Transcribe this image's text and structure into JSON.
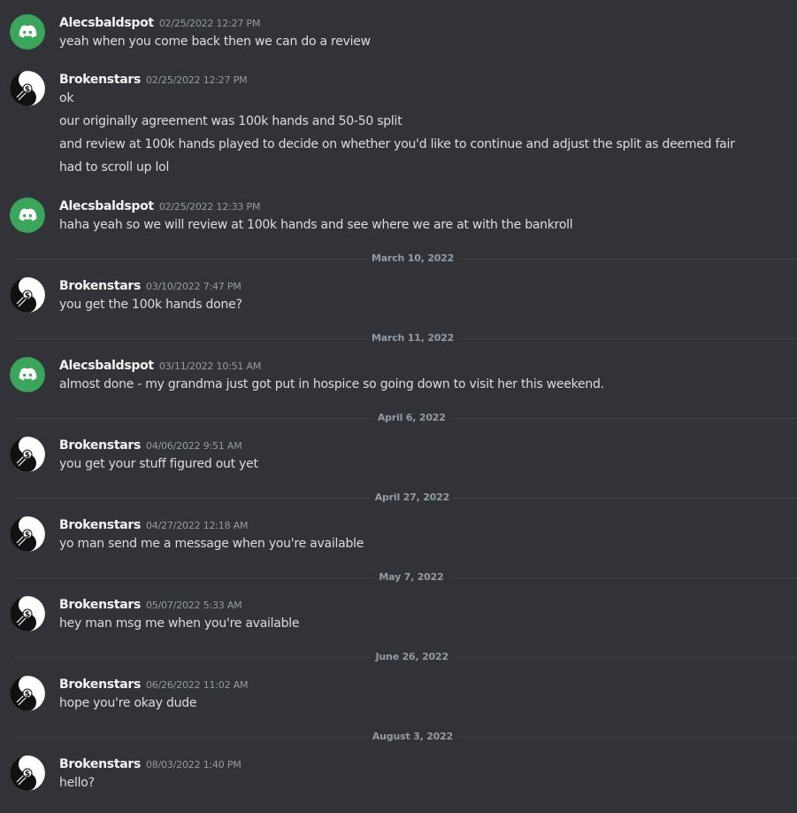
{
  "users": {
    "alec": {
      "name": "Alecsbaldspot",
      "avatar_icon": "discord-logo-icon",
      "avatar_color": "#3ba55c"
    },
    "broken": {
      "name": "Brokenstars",
      "avatar_icon": "yin-yang-dollar-icon"
    }
  },
  "messages": [
    {
      "author": "Alecsbaldspot",
      "timestamp": "02/25/2022 12:27 PM",
      "lines": [
        "yeah when you come back then we can do a review"
      ]
    },
    {
      "author": "Brokenstars",
      "timestamp": "02/25/2022 12:27 PM",
      "lines": [
        "ok",
        "our originally agreement was 100k hands and 50-50 split",
        "and review at 100k hands played to decide on whether you'd like to continue and adjust the split as deemed fair",
        "had to scroll up lol"
      ]
    },
    {
      "author": "Alecsbaldspot",
      "timestamp": "02/25/2022 12:33 PM",
      "lines": [
        "haha yeah so we will review at 100k hands and see where we are at with the bankroll"
      ]
    },
    {
      "divider": "March 10, 2022"
    },
    {
      "author": "Brokenstars",
      "timestamp": "03/10/2022 7:47 PM",
      "lines": [
        "you get the 100k hands done?"
      ]
    },
    {
      "divider": "March 11, 2022"
    },
    {
      "author": "Alecsbaldspot",
      "timestamp": "03/11/2022 10:51 AM",
      "lines": [
        "almost done - my grandma just got put in hospice so going down to visit her this weekend."
      ]
    },
    {
      "divider": "April 6, 2022"
    },
    {
      "author": "Brokenstars",
      "timestamp": "04/06/2022 9:51 AM",
      "lines": [
        "you get your stuff figured out yet"
      ]
    },
    {
      "divider": "April 27, 2022"
    },
    {
      "author": "Brokenstars",
      "timestamp": "04/27/2022 12:18 AM",
      "lines": [
        "yo man send me a message when you're available"
      ]
    },
    {
      "divider": "May 7, 2022"
    },
    {
      "author": "Brokenstars",
      "timestamp": "05/07/2022 5:33 AM",
      "lines": [
        "hey man msg me when you're available"
      ]
    },
    {
      "divider": "June 26, 2022"
    },
    {
      "author": "Brokenstars",
      "timestamp": "06/26/2022 11:02 AM",
      "lines": [
        "hope you're okay dude"
      ]
    },
    {
      "divider": "August 3, 2022"
    },
    {
      "author": "Brokenstars",
      "timestamp": "08/03/2022 1:40 PM",
      "lines": [
        "hello?"
      ]
    }
  ],
  "colors": {
    "background": "#313338",
    "author_name": "#f2f3f5",
    "message_text": "#dbdee1",
    "timestamp": "#949ba4",
    "divider_line": "#3f4147",
    "discord_avatar": "#3ba55c"
  }
}
